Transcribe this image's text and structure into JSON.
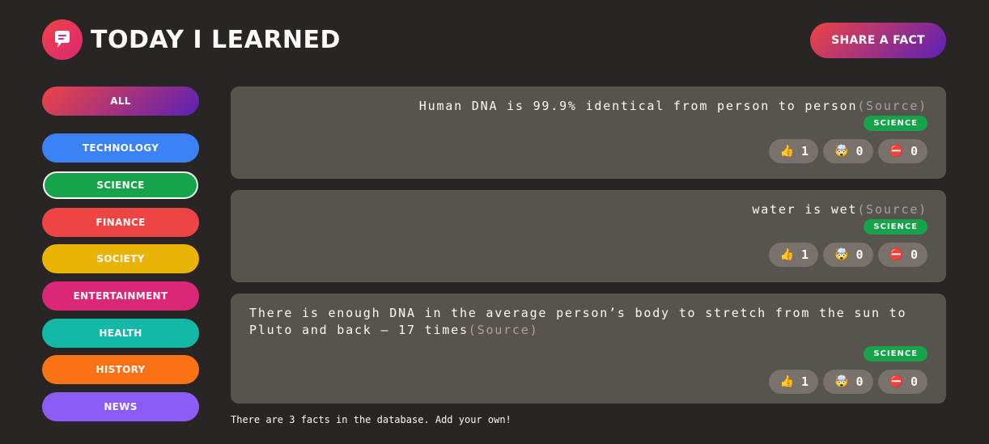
{
  "header": {
    "title": "Today I Learned",
    "share_label": "Share a fact"
  },
  "categories": [
    {
      "label": "All",
      "color": "linear-gradient(135deg, #ef4444, #5b21b6)"
    },
    {
      "label": "technology",
      "color": "#3b82f6"
    },
    {
      "label": "science",
      "color": "#16a34a"
    },
    {
      "label": "finance",
      "color": "#ef4444"
    },
    {
      "label": "society",
      "color": "#eab308"
    },
    {
      "label": "entertainment",
      "color": "#db2777"
    },
    {
      "label": "health",
      "color": "#14b8a6"
    },
    {
      "label": "history",
      "color": "#f97316"
    },
    {
      "label": "news",
      "color": "#8b5cf6"
    }
  ],
  "active_category": "science",
  "facts": [
    {
      "text": "Human DNA is 99.9% identical from person to person",
      "source": "(Source)",
      "category": "science",
      "category_color": "#16a34a",
      "votes_interesting": "1",
      "votes_mindblowing": "0",
      "votes_false": "0"
    },
    {
      "text": "water is wet",
      "source": "(Source)",
      "category": "science",
      "category_color": "#16a34a",
      "votes_interesting": "1",
      "votes_mindblowing": "0",
      "votes_false": "0"
    },
    {
      "text": "There is enough DNA in the average person’s body to stretch from the sun to Pluto and back — 17 times",
      "source": "(Source)",
      "category": "science",
      "category_color": "#16a34a",
      "votes_interesting": "1",
      "votes_mindblowing": "0",
      "votes_false": "0"
    }
  ],
  "vote_icons": {
    "interesting": "👍",
    "mindblowing": "🤯",
    "false": "⛔️"
  },
  "footer": {
    "text": "There are 3 facts in the database. Add your own!"
  }
}
